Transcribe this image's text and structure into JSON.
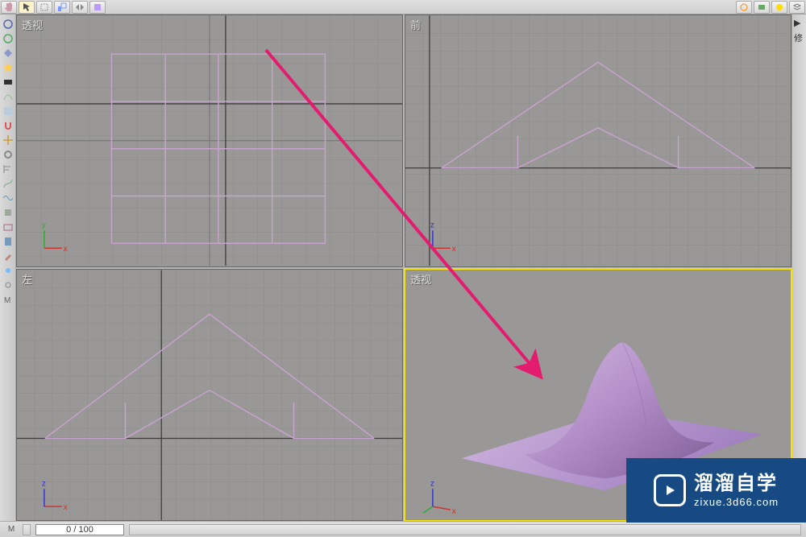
{
  "topbar": {
    "tools": [
      "hand-icon",
      "select-icon",
      "marquee-icon",
      "scale-icon",
      "mirror-icon",
      "material-icon",
      "align-icon",
      "layers-icon",
      "curve-icon",
      "snap-icon",
      "angle-snap-icon",
      "percent-snap-icon",
      "spinner-icon",
      "named-sel-icon",
      "render-setup-icon",
      "render-icon",
      "quick-render-icon"
    ]
  },
  "lefttools": {
    "items": [
      "orbit-icon",
      "pan-icon",
      "zoom-icon",
      "diamond-icon",
      "star-icon",
      "hdd-icon",
      "wire-icon",
      "paint-icon",
      "magnet-icon",
      "crosshair-icon",
      "gear-icon",
      "align2-icon",
      "path-icon",
      "wave-icon",
      "layer-icon",
      "box-icon",
      "clip-icon",
      "brush-icon",
      "snap2-icon",
      "link-icon",
      "modifier-icon"
    ]
  },
  "rightpanel": {
    "cursor": "▶",
    "label": "修"
  },
  "viewports": {
    "tl": {
      "label": "透视",
      "axes": [
        "y",
        "x"
      ]
    },
    "tr": {
      "label": "前",
      "axes": [
        "z",
        "x"
      ]
    },
    "bl": {
      "label": "左",
      "axes": [
        "z",
        "x"
      ]
    },
    "br": {
      "label": "透视",
      "axes": [
        "z",
        "x"
      ],
      "active": true
    }
  },
  "timeline": {
    "text": "0 / 100"
  },
  "watermark": {
    "cn": "溜溜自学",
    "url": "zixue.3d66.com"
  },
  "colors": {
    "wire": "#caa3d1",
    "wire_dark": "#a986b8",
    "grid_major": "#6f6f6f",
    "grid_minor": "#8c8c8c",
    "axis": "#3d3d3d",
    "arrow": "#e31c6f",
    "active": "#f6e200",
    "axis_x": "#cc3333",
    "axis_y": "#33aa33",
    "axis_z": "#3333cc"
  }
}
